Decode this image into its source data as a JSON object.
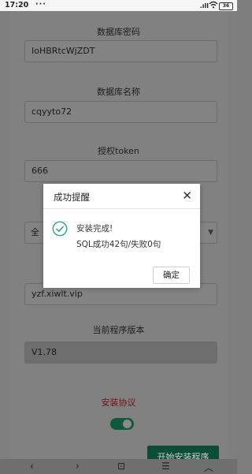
{
  "statusbar": {
    "time": "17:20",
    "dots": "···",
    "signal": ".ıll",
    "wifi": "wifi-icon",
    "battery": "36"
  },
  "form": {
    "db_password_label": "数据库密码",
    "db_password_value": "IoHBRtcWjZDT",
    "db_name_label": "数据库名称",
    "db_name_value": "cqyyto72",
    "token_label": "授权token",
    "token_value": "666",
    "select_value": "全",
    "domain_value": "yzf.xiwlt.vip",
    "version_label": "当前程序版本",
    "version_value": "V1.78",
    "agreement_label": "安装协议",
    "install_button": "开始安装程序"
  },
  "dialog": {
    "title": "成功提醒",
    "message_line1": "安装完成!",
    "message_line2": "SQL成功42句/失败0句",
    "confirm_label": "确定"
  },
  "navbar": {
    "back": "‹",
    "forward": "›",
    "home": "⊡",
    "menu": "☰",
    "up": "︿"
  },
  "colors": {
    "success": "#2ca58d",
    "accent": "#0b4d36",
    "agreement": "#6b1313"
  }
}
